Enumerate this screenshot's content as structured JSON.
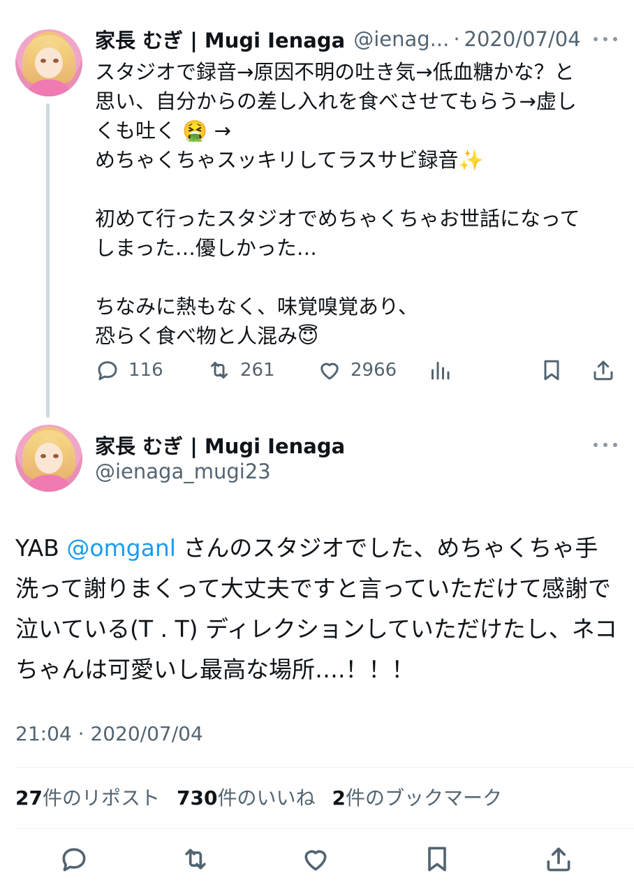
{
  "reply_tweet": {
    "name": "家長 むぎ | Mugi Ienaga",
    "handle": "@ienag...",
    "separator": "·",
    "date": "2020/07/04",
    "text": "スタジオで録音→原因不明の吐き気→低血糖かな？と\n思い、自分からの差し入れを食べさせてもらう→虚し\nくも吐く 🤮 →\nめちゃくちゃスッキリしてラスサビ録音✨\n\n初めて行ったスタジオでめちゃくちゃお世話になって\nしまった…優しかった…\n\nちなみに熱もなく、味覚嗅覚あり、\n恐らく食べ物と人混み😇",
    "replies": "116",
    "reposts": "261",
    "likes": "2966",
    "icons": [
      "reply-icon",
      "repost-icon",
      "like-icon",
      "views-icon",
      "bookmark-icon",
      "share-icon"
    ]
  },
  "main_tweet": {
    "name": "家長 むぎ | Mugi Ienaga",
    "handle": "@ienaga_mugi23",
    "text_prefix": "YAB ",
    "mention": "@omganl",
    "text_suffix": " さんのスタジオでした、めちゃくちゃ手洗って謝りまくって大丈夫ですと言っていただけて感謝で泣いている(T . T) ディレクションしていただけたし、ネコちゃんは可愛いし最高な場所….！！！",
    "timestamp": "21:04 · 2020/07/04",
    "stats": {
      "reposts_count": "27",
      "reposts_label": "件のリポスト",
      "likes_count": "730",
      "likes_label": "件のいいね",
      "bookmarks_count": "2",
      "bookmarks_label": "件のブックマーク"
    },
    "icons": [
      "reply-icon",
      "repost-icon",
      "like-icon",
      "bookmark-icon",
      "share-icon"
    ]
  },
  "colors": {
    "text": "#0f1419",
    "secondary": "#536471",
    "mention": "#1d9bf0",
    "divider": "#eff3f4",
    "thread_line": "#cfd9de"
  }
}
